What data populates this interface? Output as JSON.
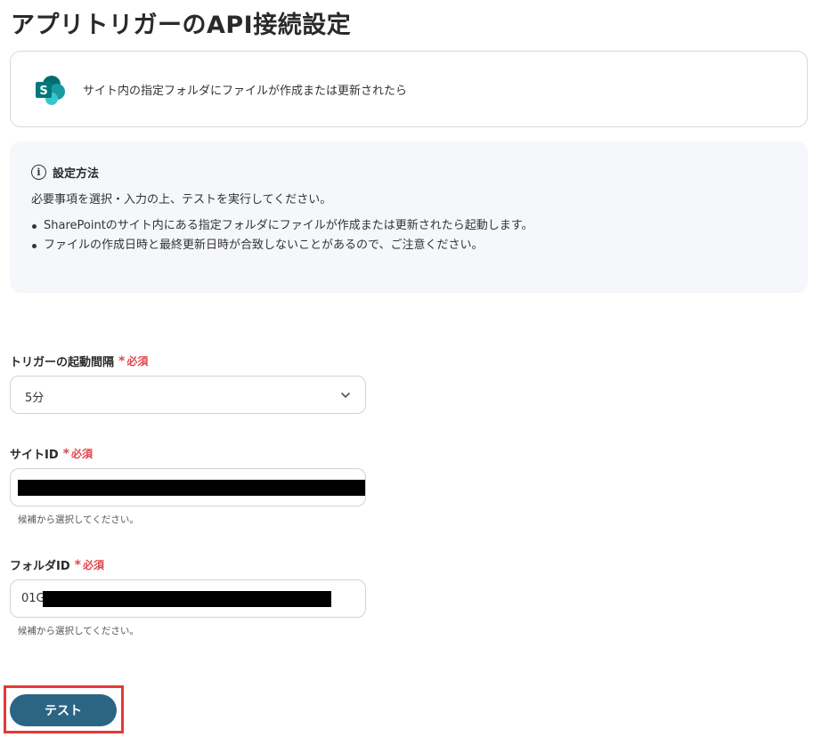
{
  "page": {
    "title": "アプリトリガーのAPI接続設定"
  },
  "trigger": {
    "app_icon": "sharepoint-logo",
    "description": "サイト内の指定フォルダにファイルが作成または更新されたら"
  },
  "info": {
    "icon": "info-circle-icon",
    "title": "設定方法",
    "description": "必要事項を選択・入力の上、テストを実行してください。",
    "bullets": [
      "SharePointのサイト内にある指定フォルダにファイルが作成または更新されたら起動します。",
      "ファイルの作成日時と最終更新日時が合致しないことがあるので、ご注意ください。"
    ]
  },
  "fields": {
    "interval": {
      "label": "トリガーの起動間隔",
      "required": "必須",
      "value": "5分"
    },
    "site_id": {
      "label": "サイトID",
      "required": "必須",
      "hint": "候補から選択してください。"
    },
    "folder_id": {
      "label": "フォルダID",
      "required": "必須",
      "prefix": "01G",
      "hint": "候補から選択してください。"
    }
  },
  "actions": {
    "test_label": "テスト"
  },
  "colors": {
    "primary": "#2c6584",
    "required": "#e0474f",
    "highlight": "#e53935"
  }
}
